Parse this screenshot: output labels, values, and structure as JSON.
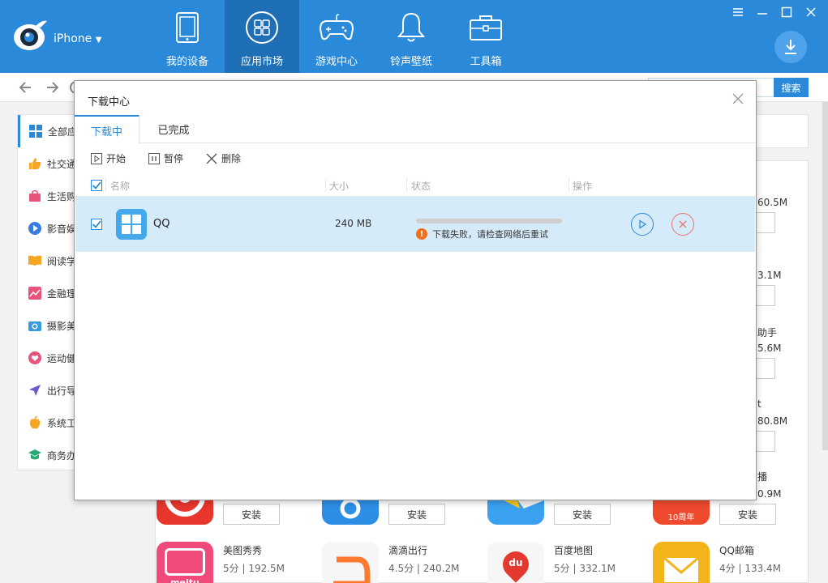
{
  "header": {
    "device_name": "iPhone",
    "nav": [
      {
        "label": "我的设备",
        "icon": "tablet-icon"
      },
      {
        "label": "应用市场",
        "icon": "apps-grid-icon"
      },
      {
        "label": "游戏中心",
        "icon": "gamepad-icon"
      },
      {
        "label": "铃声壁纸",
        "icon": "bell-icon"
      },
      {
        "label": "工具箱",
        "icon": "toolbox-icon"
      }
    ],
    "active_nav": 1,
    "accent_color": "#2a8ad9"
  },
  "search": {
    "button_label": "搜索",
    "value": ""
  },
  "sidebar": {
    "items": [
      {
        "label": "全部应",
        "icon": "grid-icon"
      },
      {
        "label": "社交通",
        "icon": "thumbs-up-icon"
      },
      {
        "label": "生活购",
        "icon": "shopping-bag-icon"
      },
      {
        "label": "影音娱",
        "icon": "play-circle-icon"
      },
      {
        "label": "阅读学",
        "icon": "book-icon"
      },
      {
        "label": "金融理",
        "icon": "chart-icon"
      },
      {
        "label": "摄影美",
        "icon": "camera-icon"
      },
      {
        "label": "运动健",
        "icon": "heart-icon"
      },
      {
        "label": "出行导",
        "icon": "navigation-icon"
      },
      {
        "label": "系统工",
        "icon": "apple-icon"
      },
      {
        "label": "商务办",
        "icon": "graduation-cap-icon"
      }
    ]
  },
  "background_apps": {
    "right_column_peeks": [
      "60.5M",
      "3.1M",
      "助手",
      "5.6M",
      "t",
      "80.8M",
      "播",
      "0.9M"
    ],
    "install_label": "安装",
    "row_bottom": [
      {
        "name": "美图秀秀",
        "rating": "5分",
        "size": "192.5M",
        "icon_text": "meitu",
        "icon_color": "#f04a7a"
      },
      {
        "name": "滴滴出行",
        "rating": "4.5分",
        "size": "240.2M",
        "icon_text": "",
        "icon_color": "#ff7a2f"
      },
      {
        "name": "百度地图",
        "rating": "5分",
        "size": "332.1M",
        "icon_text": "du",
        "icon_color": "#e23a2e"
      },
      {
        "name": "QQ邮箱",
        "rating": "4分",
        "size": "133.4M",
        "icon_text": "",
        "icon_color": "#f3b31a"
      }
    ],
    "row_top_badge": "10周年"
  },
  "dialog": {
    "title": "下载中心",
    "tabs": [
      {
        "label": "下载中"
      },
      {
        "label": "已完成"
      }
    ],
    "actions": [
      {
        "label": "开始",
        "icon": "play-square-icon"
      },
      {
        "label": "暂停",
        "icon": "pause-square-icon"
      },
      {
        "label": "删除",
        "icon": "x-icon"
      }
    ],
    "columns": {
      "name": "名称",
      "size": "大小",
      "status": "状态",
      "ops": "操作"
    },
    "rows": [
      {
        "name": "QQ",
        "size": "240 MB",
        "progress": 0,
        "error": "下载失败，请检查网络后重试",
        "checked": true
      }
    ]
  }
}
